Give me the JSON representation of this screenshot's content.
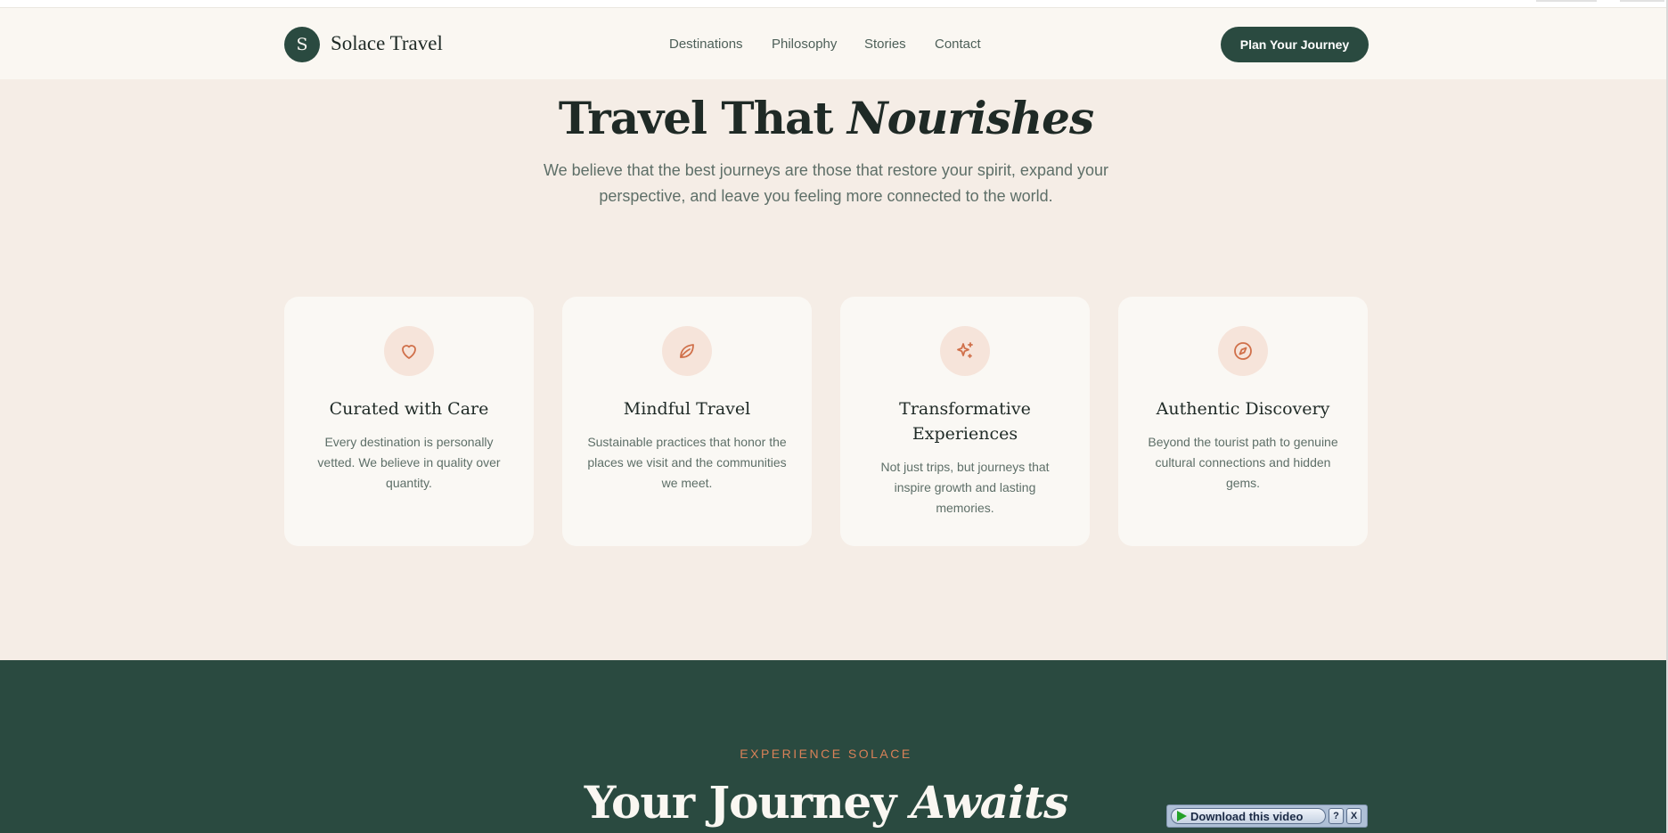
{
  "brand": {
    "logo_letter": "S",
    "name": "Solace Travel"
  },
  "nav": {
    "items": [
      {
        "label": "Destinations"
      },
      {
        "label": "Philosophy"
      },
      {
        "label": "Stories"
      },
      {
        "label": "Contact"
      }
    ],
    "cta_label": "Plan Your Journey"
  },
  "hero": {
    "title_plain": "Travel That",
    "title_italic": "Nourishes",
    "subtitle": "We believe that the best journeys are those that restore your spirit, expand your perspective, and leave you feeling more connected to the world."
  },
  "values": [
    {
      "icon": "heart-icon",
      "title": "Curated with Care",
      "text": "Every destination is personally vetted. We believe in quality over quantity."
    },
    {
      "icon": "leaf-icon",
      "title": "Mindful Travel",
      "text": "Sustainable practices that honor the places we visit and the communities we meet."
    },
    {
      "icon": "sparkle-icon",
      "title": "Transformative Experiences",
      "text": "Not just trips, but journeys that inspire growth and lasting memories."
    },
    {
      "icon": "compass-icon",
      "title": "Authentic Discovery",
      "text": "Beyond the tourist path to genuine cultural connections and hidden gems."
    }
  ],
  "experience": {
    "eyebrow": "EXPERIENCE SOLACE",
    "title_plain": "Your Journey",
    "title_italic": "Awaits"
  },
  "download_widget": {
    "label": "Download this video",
    "help": "?",
    "close": "X"
  },
  "colors": {
    "primary_green": "#2a4a40",
    "accent_terracotta": "#d98158",
    "page_cream": "#f5ede6",
    "header_bg": "#faf7f2",
    "card_bg": "#faf8f4",
    "icon_circle": "#f6e4da"
  }
}
